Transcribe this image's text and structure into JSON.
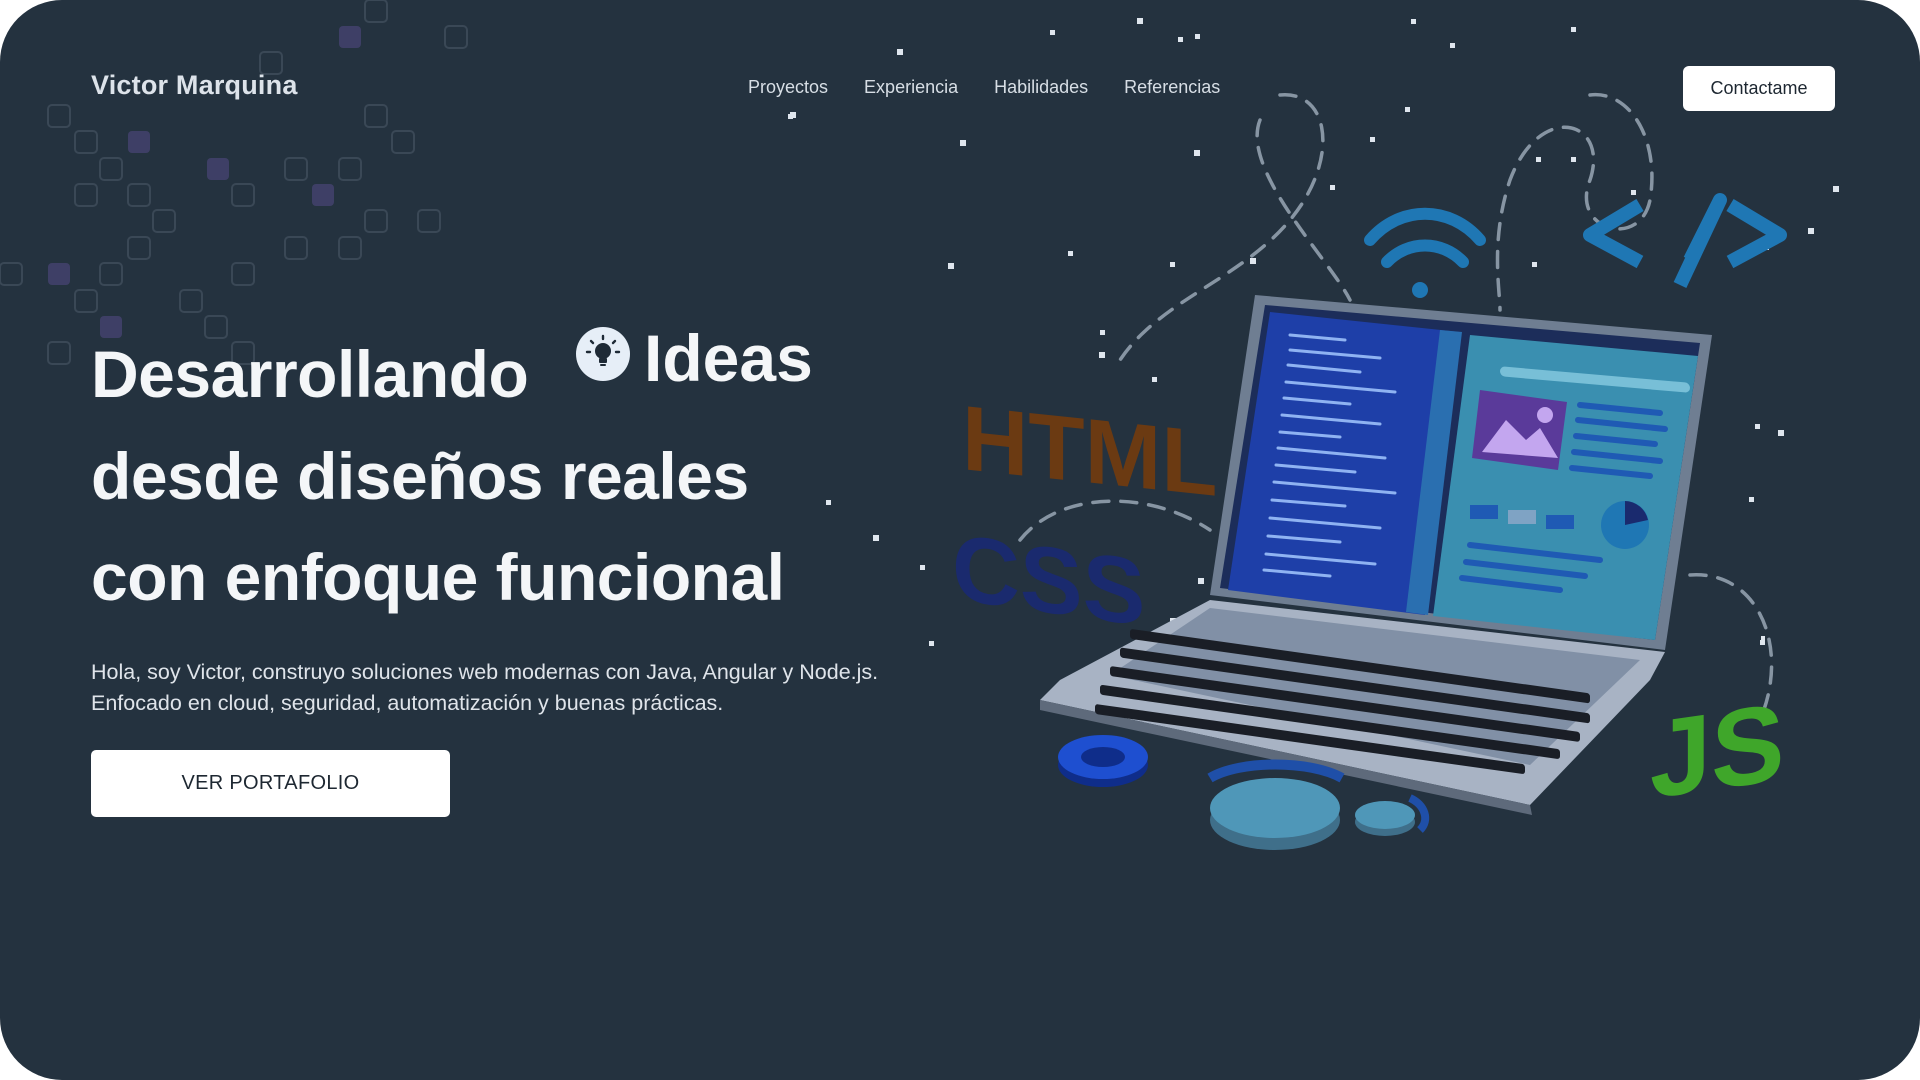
{
  "header": {
    "brand": "Victor Marquina",
    "nav": [
      "Proyectos",
      "Experiencia",
      "Habilidades",
      "Referencias"
    ],
    "contact_label": "Contactame"
  },
  "hero": {
    "line1": "Desarrollando",
    "ideas": "Ideas",
    "line2": "desde diseños reales",
    "line3": "con enfoque funcional",
    "intro_line1": "Hola, soy Victor, construyo soluciones web modernas con Java, Angular y Node.js.",
    "intro_line2": "Enfocado en cloud, seguridad, automatización y buenas prácticas.",
    "cta_label": "VER PORTAFOLIO"
  },
  "illustration": {
    "html_text": "HTML",
    "css_text": "CSS",
    "js_text": "JS",
    "code_icon": "</>",
    "icons": [
      "wifi-icon",
      "code-tag-icon",
      "at-sign-icon",
      "gear-icon",
      "lightbulb-icon",
      "laptop"
    ]
  },
  "colors": {
    "background": "#24323f",
    "html": "#6b3a12",
    "css": "#1a2a6e",
    "js": "#3fa62a",
    "accent_blue": "#1f77b4"
  }
}
